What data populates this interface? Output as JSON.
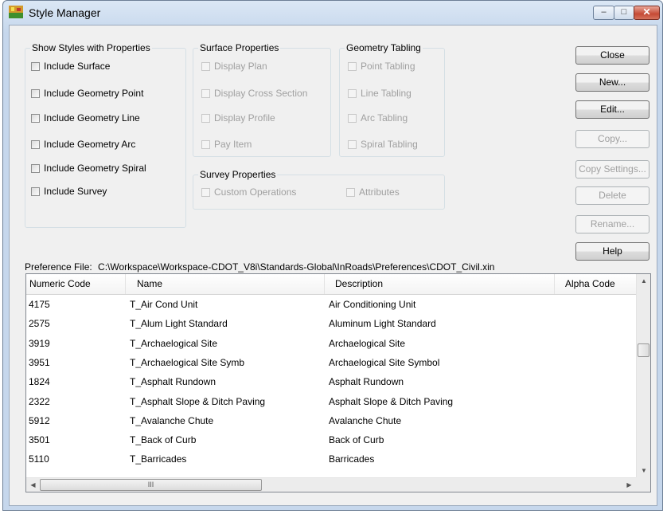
{
  "window": {
    "title": "Style Manager",
    "controls": {
      "minimize": "–",
      "maximize": "□",
      "close": "✕"
    }
  },
  "show_styles": {
    "title": "Show Styles with Properties",
    "items": [
      "Include Surface",
      "Include Geometry Point",
      "Include Geometry Line",
      "Include Geometry Arc",
      "Include Geometry Spiral",
      "Include Survey"
    ]
  },
  "surface_properties": {
    "title": "Surface Properties",
    "items": [
      "Display Plan",
      "Display Cross Section",
      "Display Profile",
      "Pay Item"
    ]
  },
  "geometry_tabling": {
    "title": "Geometry Tabling",
    "items": [
      "Point Tabling",
      "Line Tabling",
      "Arc Tabling",
      "Spiral Tabling"
    ]
  },
  "survey_properties": {
    "title": "Survey Properties",
    "items": [
      "Custom Operations",
      "Attributes"
    ]
  },
  "buttons": {
    "close": "Close",
    "new": "New...",
    "edit": "Edit...",
    "copy": "Copy...",
    "copy_settings": "Copy Settings...",
    "delete": "Delete",
    "rename": "Rename...",
    "help": "Help"
  },
  "preference_file": {
    "label": "Preference File:",
    "path": "C:\\Workspace\\Workspace-CDOT_V8i\\Standards-Global\\InRoads\\Preferences\\CDOT_Civil.xin"
  },
  "table": {
    "columns": [
      "Numeric Code",
      "Name",
      "Description",
      "Alpha Code"
    ],
    "rows": [
      [
        "4175",
        "T_Air Cond Unit",
        "Air Conditioning Unit",
        ""
      ],
      [
        "2575",
        "T_Alum Light Standard",
        "Aluminum Light Standard",
        ""
      ],
      [
        "3919",
        "T_Archaelogical Site",
        "Archaelogical Site",
        ""
      ],
      [
        "3951",
        "T_Archaelogical Site Symb",
        "Archaelogical Site Symbol",
        ""
      ],
      [
        "1824",
        "T_Asphalt Rundown",
        "Asphalt Rundown",
        ""
      ],
      [
        "2322",
        "T_Asphalt Slope & Ditch Paving",
        "Asphalt Slope & Ditch Paving",
        ""
      ],
      [
        "5912",
        "T_Avalanche Chute",
        "Avalanche Chute",
        ""
      ],
      [
        "3501",
        "T_Back of Curb",
        "Back of Curb",
        ""
      ],
      [
        "5110",
        "T_Barricades",
        "Barricades",
        ""
      ]
    ]
  },
  "scrollbar": {
    "thumb_grip": "III",
    "up": "▲",
    "down": "▼",
    "left": "◀",
    "right": "▶"
  }
}
